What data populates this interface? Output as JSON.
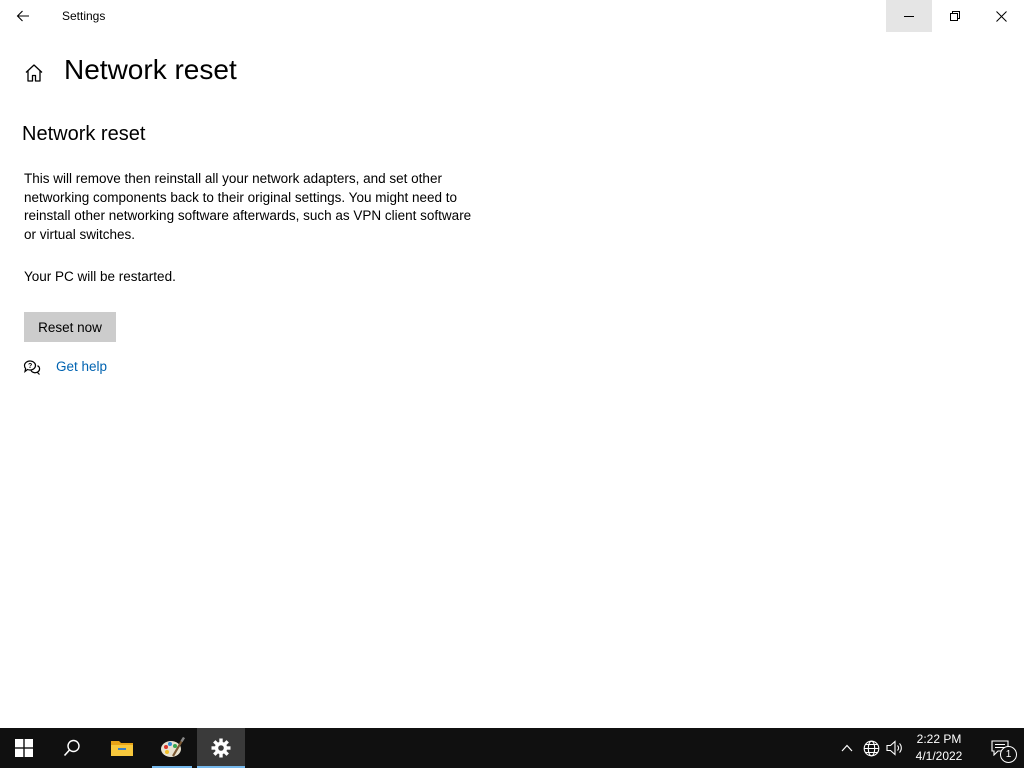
{
  "window": {
    "app_title": "Settings",
    "controls": [
      "minimize",
      "restore",
      "close"
    ]
  },
  "header": {
    "page_title": "Network reset"
  },
  "content": {
    "section_title": "Network reset",
    "description": "This will remove then reinstall all your network adapters, and set other networking components back to their original settings. You might need to reinstall other networking software afterwards, such as VPN client software or virtual switches.",
    "restart_note": "Your PC will be restarted.",
    "reset_button_label": "Reset now",
    "help_link_label": "Get help"
  },
  "taskbar": {
    "apps": [
      "start-icon",
      "search-icon",
      "file-explorer-icon",
      "paint-icon",
      "settings-icon"
    ],
    "active_app": "settings-icon",
    "clock": {
      "time": "2:22 PM",
      "date": "4/1/2022"
    },
    "notification_count": "1"
  },
  "colors": {
    "accent_link": "#0063b1",
    "button_bg": "#cccccc",
    "taskbar_bg": "#101010",
    "taskbar_active": "#76b9ed"
  }
}
